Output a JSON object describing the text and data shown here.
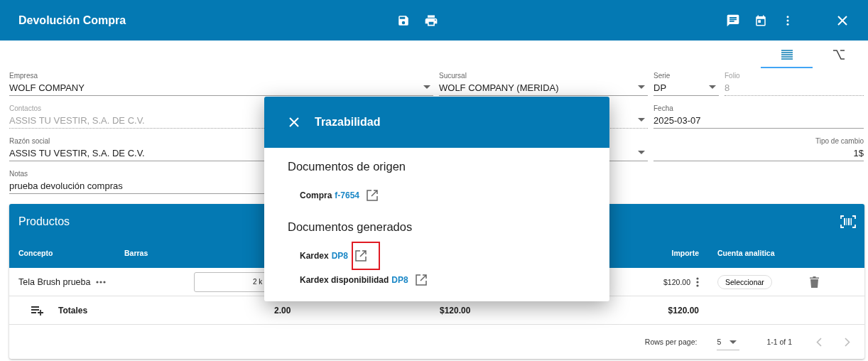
{
  "header": {
    "title": "Devolución Compra"
  },
  "view_tabs": [
    {
      "kind": "list",
      "selected": true
    },
    {
      "kind": "formula",
      "selected": false
    }
  ],
  "fields": {
    "empresa": {
      "label": "Empresa",
      "value": "WOLF COMPANY",
      "dropdown": true,
      "disabled": false
    },
    "sucursal": {
      "label": "Sucursal",
      "value": "WOLF COMPANY (MERIDA)",
      "dropdown": true,
      "disabled": false
    },
    "serie": {
      "label": "Serie",
      "value": "DP",
      "dropdown": true,
      "disabled": false
    },
    "folio": {
      "label": "Folio",
      "value": "8",
      "dropdown": false,
      "disabled": true
    },
    "contactos": {
      "label": "Contactos",
      "value": "ASSIS TU VESTIR, S.A. DE C.V.",
      "dropdown": true,
      "disabled": true
    },
    "fecha": {
      "label": "Fecha",
      "value": "2025-03-07",
      "dropdown": false,
      "disabled": false
    },
    "razon_social": {
      "label": "Razón social",
      "value": "ASSIS TU VESTIR, S.A. DE C.V.",
      "dropdown": true,
      "disabled": false
    },
    "tipo_cambio": {
      "label": "Tipo de cambio",
      "value": "1$",
      "dropdown": false,
      "disabled": false
    },
    "notas": {
      "label": "Notas",
      "value": "prueba devolución compras",
      "dropdown": false,
      "disabled": false
    }
  },
  "products": {
    "title": "Productos",
    "columns": [
      {
        "label": "Concepto"
      },
      {
        "label": "Barras"
      },
      {
        "label": "Importe"
      },
      {
        "label": "Cuenta analitica"
      }
    ],
    "rows": [
      {
        "concepto": "Tela Brush prueba",
        "cantidad": "2 k",
        "importe": "$120.00",
        "cuenta_button": "Seleccionar"
      }
    ],
    "totals": {
      "label": "Totales",
      "cantidad": "2.00",
      "column_4": "$120.00",
      "importe": "$120.00"
    },
    "pagination": {
      "label": "Rows per page:",
      "per_page": "5",
      "range": "1-1 of 1",
      "prev_disabled": true,
      "next_disabled": true
    }
  },
  "dialog": {
    "title": "Trazabilidad",
    "sections": [
      {
        "heading": "Documentos de origen",
        "items": [
          {
            "label": "Compra",
            "link": "f-7654",
            "highlighted": false
          }
        ]
      },
      {
        "heading": "Documentos generados",
        "items": [
          {
            "label": "Kardex",
            "link": "DP8",
            "highlighted": true
          },
          {
            "label": "Kardex disponibilidad",
            "link": "DP8",
            "highlighted": false
          }
        ]
      }
    ]
  }
}
